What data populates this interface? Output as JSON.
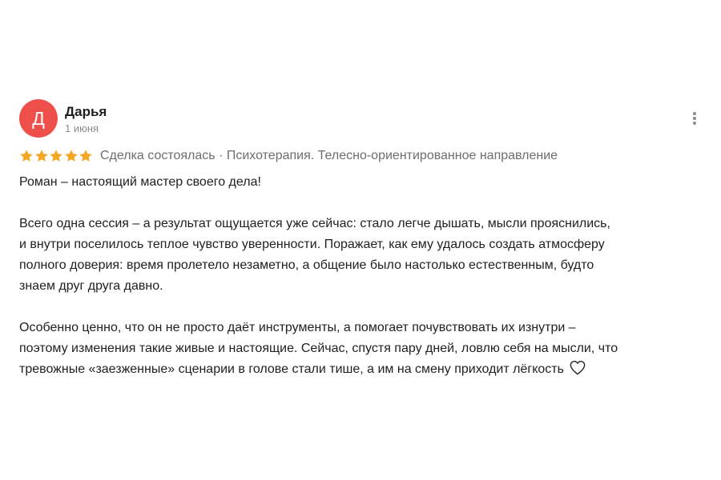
{
  "review": {
    "avatar_letter": "Д",
    "author": "Дарья",
    "date": "1 июня",
    "rating": 5,
    "rating_max": 5,
    "star_color": "#f5a623",
    "avatar_color": "#ef4f4a",
    "meta": "Сделка состоялась · Психотерапия. Телесно-ориентированное направление",
    "paragraphs": [
      [
        "Роман – настоящий мастер своего дела!"
      ],
      [
        "Всего одна сессия – а результат ощущается уже сейчас: стало легче дышать, мысли прояснились,",
        "и внутри поселилось теплое чувство уверенности. Поражает, как ему удалось создать атмосферу",
        "полного доверия: время пролетело незаметно, а общение было настолько естественным, будто",
        "знаем друг друга давно."
      ],
      [
        "Особенно ценно, что он не просто даёт инструменты, а помогает почувствовать их изнутри –",
        "поэтому изменения такие живые и настоящие. Сейчас, спустя пару дней, ловлю себя на мысли, что",
        "тревожные «заезженные» сценарии в голове стали тише, а им на смену приходит лёгкость"
      ]
    ],
    "end_icon": "heart-outline-icon"
  }
}
